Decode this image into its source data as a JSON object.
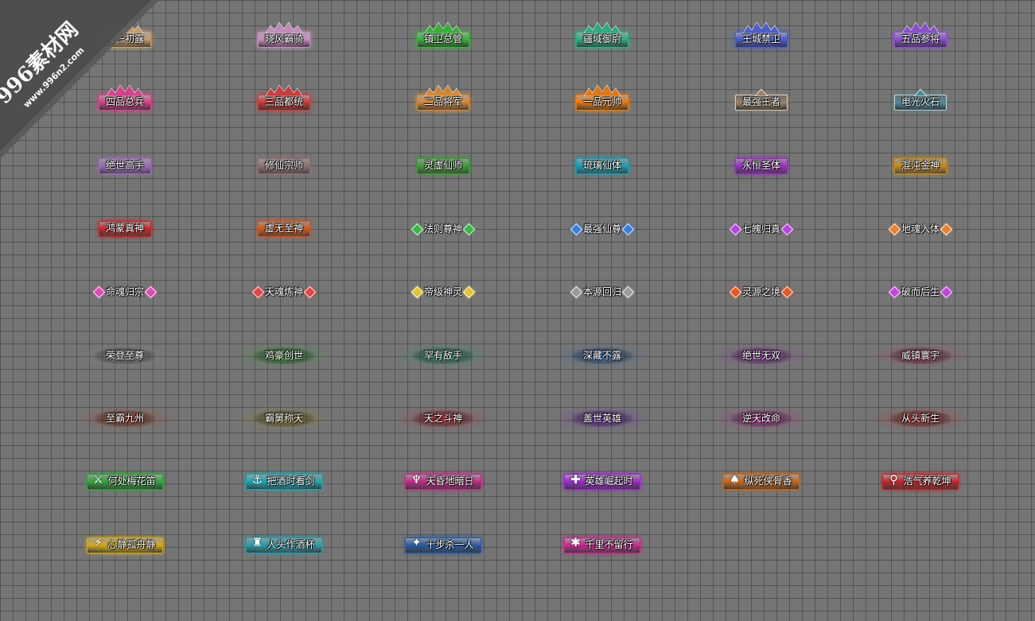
{
  "watermark": {
    "title": "996素材网",
    "url": "www.996n2.com"
  },
  "titles": [
    [
      {
        "text": "锋芒初露",
        "style": "crest",
        "color": "#c7a071",
        "icon": ""
      },
      {
        "text": "晓风霸骑",
        "style": "crest",
        "color": "#c98fc0",
        "icon": ""
      },
      {
        "text": "镇卫总管",
        "style": "crest",
        "color": "#39b33a",
        "icon": ""
      },
      {
        "text": "疆域御尉",
        "style": "crest",
        "color": "#2fae86",
        "icon": ""
      },
      {
        "text": "王城禁卫",
        "style": "crest",
        "color": "#4c5dcf",
        "icon": ""
      },
      {
        "text": "五品参将",
        "style": "crest",
        "color": "#8a4ed0",
        "icon": ""
      }
    ],
    [
      {
        "text": "四品总兵",
        "style": "crest",
        "color": "#d8418c",
        "icon": ""
      },
      {
        "text": "三品都统",
        "style": "crest",
        "color": "#cc3a3a",
        "icon": ""
      },
      {
        "text": "二品将军",
        "style": "crest",
        "color": "#d98a36",
        "icon": ""
      },
      {
        "text": "一品元帅",
        "style": "crest",
        "color": "#e87b12",
        "icon": ""
      },
      {
        "text": "最强王者",
        "style": "plate",
        "color": "#9a8068",
        "icon": ""
      },
      {
        "text": "电光火石",
        "style": "plate",
        "color": "#4f8c9a",
        "icon": ""
      }
    ],
    [
      {
        "text": "绝世高手",
        "style": "bar",
        "color": "#9b6bb5",
        "icon": ""
      },
      {
        "text": "修仙宗师",
        "style": "bar",
        "color": "#8e6e70",
        "icon": ""
      },
      {
        "text": "灵虚仙师",
        "style": "bar",
        "color": "#3c9a32",
        "icon": ""
      },
      {
        "text": "琉璃仙体",
        "style": "bar",
        "color": "#1c9bb0",
        "icon": ""
      },
      {
        "text": "永恒圣体",
        "style": "bar",
        "color": "#9a2cc2",
        "icon": ""
      },
      {
        "text": "混沌金神",
        "style": "bar",
        "color": "#c28a1c",
        "icon": ""
      }
    ],
    [
      {
        "text": "鸿蒙真神",
        "style": "bar",
        "color": "#c4262a",
        "icon": ""
      },
      {
        "text": "虚无至神",
        "style": "bar",
        "color": "#d0561c",
        "icon": ""
      },
      {
        "text": "法则尊神",
        "style": "gem",
        "color": "#3db34a",
        "icon": ""
      },
      {
        "text": "最强仙尊",
        "style": "gem",
        "color": "#3d7fd6",
        "icon": ""
      },
      {
        "text": "七魄归真",
        "style": "gem",
        "color": "#b347d9",
        "icon": ""
      },
      {
        "text": "地魂入体",
        "style": "gem",
        "color": "#e0843a",
        "icon": ""
      }
    ],
    [
      {
        "text": "命魂归宗",
        "style": "gem",
        "color": "#d94fb0",
        "icon": ""
      },
      {
        "text": "天魂炼神",
        "style": "gem",
        "color": "#e04848",
        "icon": ""
      },
      {
        "text": "帝级神灵",
        "style": "gem",
        "color": "#e0c43a",
        "icon": ""
      },
      {
        "text": "本源回归",
        "style": "gem",
        "color": "#9a9a9a",
        "icon": ""
      },
      {
        "text": "灵源之境",
        "style": "gem",
        "color": "#e05a2a",
        "icon": ""
      },
      {
        "text": "破而后生",
        "style": "gem",
        "color": "#c04ad8",
        "icon": ""
      }
    ],
    [
      {
        "text": "荣登至尊",
        "style": "mist",
        "color": "#8c8c8c",
        "icon": ""
      },
      {
        "text": "鸡豪创世",
        "style": "mist",
        "color": "#3aa33a",
        "icon": ""
      },
      {
        "text": "罕有敌手",
        "style": "mist",
        "color": "#2a9a7a",
        "icon": ""
      },
      {
        "text": "深藏不露",
        "style": "mist",
        "color": "#3a6bb0",
        "icon": ""
      },
      {
        "text": "绝世无双",
        "style": "mist",
        "color": "#9a3ab8",
        "icon": ""
      },
      {
        "text": "威镇寰宇",
        "style": "mist",
        "color": "#b03a5a",
        "icon": ""
      }
    ],
    [
      {
        "text": "至霸九州",
        "style": "mist",
        "color": "#b0422a",
        "icon": ""
      },
      {
        "text": "霸舅称天",
        "style": "mist",
        "color": "#a08a2a",
        "icon": ""
      },
      {
        "text": "天之斗神",
        "style": "mist",
        "color": "#c02a3a",
        "icon": ""
      },
      {
        "text": "盖世英雄",
        "style": "mist",
        "color": "#7a2ac0",
        "icon": ""
      },
      {
        "text": "逆天改命",
        "style": "mist",
        "color": "#c02a9a",
        "icon": ""
      },
      {
        "text": "从头新生",
        "style": "mist",
        "color": "#c02a2a",
        "icon": ""
      }
    ],
    [
      {
        "text": "何处梅花笛",
        "style": "weapon",
        "color": "#2fa33a",
        "icon": "⚔"
      },
      {
        "text": "把酒时看剑",
        "style": "weapon",
        "color": "#1fa3b0",
        "icon": "⚓"
      },
      {
        "text": "天昏地暗日",
        "style": "weapon",
        "color": "#c02a8a",
        "icon": "♆"
      },
      {
        "text": "英雄崛起时",
        "style": "weapon",
        "color": "#9a2ac8",
        "icon": "✚"
      },
      {
        "text": "纵死侠骨香",
        "style": "weapon",
        "color": "#c4661c",
        "icon": "♠"
      },
      {
        "text": "浩气养乾坤",
        "style": "weapon",
        "color": "#c0262a",
        "icon": "⚲"
      }
    ],
    [
      {
        "text": "心静孤舟静",
        "style": "weapon",
        "color": "#d0a81c",
        "icon": "⚡"
      },
      {
        "text": "人头作酒杯",
        "style": "weapon",
        "color": "#2a9aa8",
        "icon": "♜"
      },
      {
        "text": "十步杀一人",
        "style": "weapon",
        "color": "#2a5aa0",
        "icon": "✦"
      },
      {
        "text": "千里不留行",
        "style": "weapon",
        "color": "#c02a8a",
        "icon": "✱"
      }
    ]
  ]
}
